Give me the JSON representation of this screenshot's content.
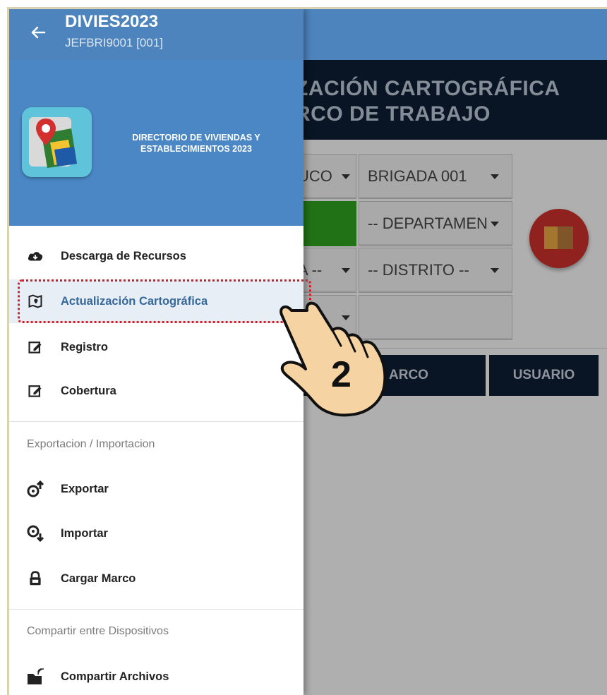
{
  "header": {
    "title": "DIVIES2023",
    "subtitle": "JEFBRI9001 [001]"
  },
  "banner": {
    "app_name": "DIRECTORIO DE VIVIENDAS Y ESTABLECIMIENTOS 2023"
  },
  "menu": {
    "items": [
      {
        "label": "Descarga de Recursos",
        "icon": "cloud-download-icon"
      },
      {
        "label": "Actualización Cartográfica",
        "icon": "map-icon",
        "selected": true
      },
      {
        "label": "Registro",
        "icon": "edit-icon"
      },
      {
        "label": "Cobertura",
        "icon": "edit-icon"
      }
    ],
    "section1": {
      "title": "Exportacion / Importacion",
      "items": [
        {
          "label": "Exportar",
          "icon": "export-icon"
        },
        {
          "label": "Importar",
          "icon": "import-icon"
        },
        {
          "label": "Cargar Marco",
          "icon": "lock-icon"
        }
      ]
    },
    "section2": {
      "title": "Compartir entre Dispositivos",
      "items": [
        {
          "label": "Compartir Archivos",
          "icon": "share-files-icon"
        }
      ]
    }
  },
  "background": {
    "title_line1": "ZACIÓN CARTOGRÁFICA",
    "title_line2": "RCO DE TRABAJO",
    "dropdowns": {
      "partial1": "UCO",
      "brigada": "BRIGADA 001",
      "departamento": "-- DEPARTAMEN",
      "partial2": "A --",
      "distrito": "-- DISTRITO --"
    },
    "table_headers": {
      "marco": "ARCO",
      "usuario": "USUARIO"
    }
  },
  "annotation": {
    "step_number": "2"
  },
  "colors": {
    "header_blue": "#4d84bd",
    "dark_navy": "#0d1d33",
    "highlight_red": "#d51f26",
    "selected_text": "#35689b"
  }
}
